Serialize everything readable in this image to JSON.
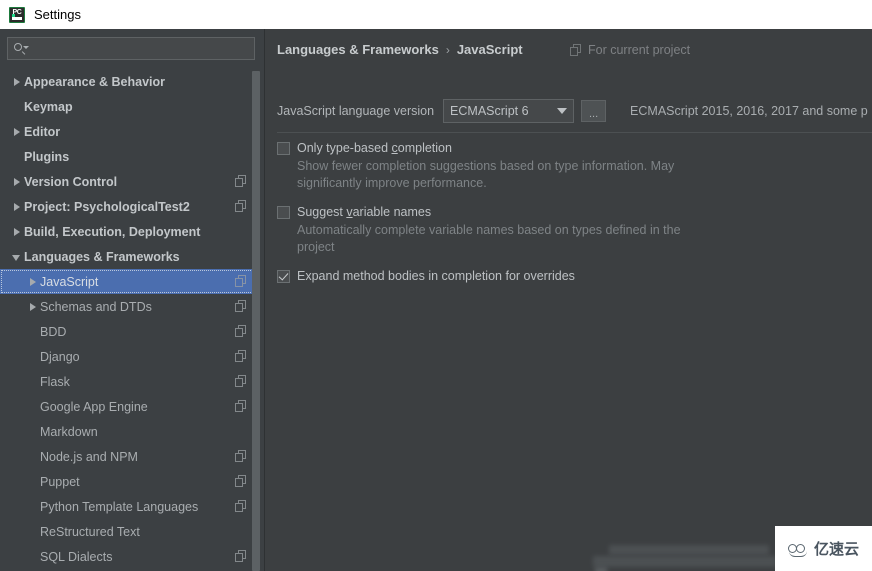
{
  "window": {
    "title": "Settings",
    "app_icon": "pycharm-icon"
  },
  "sidebar": {
    "search": {
      "placeholder": "",
      "value": "",
      "icon": "search-icon"
    },
    "items": [
      {
        "label": "Appearance & Behavior",
        "twisty": "right",
        "level": 0,
        "bold": true,
        "copy": false,
        "selected": false
      },
      {
        "label": "Keymap",
        "twisty": "none",
        "level": 0,
        "bold": true,
        "copy": false,
        "selected": false
      },
      {
        "label": "Editor",
        "twisty": "right",
        "level": 0,
        "bold": true,
        "copy": false,
        "selected": false
      },
      {
        "label": "Plugins",
        "twisty": "none",
        "level": 0,
        "bold": true,
        "copy": false,
        "selected": false
      },
      {
        "label": "Version Control",
        "twisty": "right",
        "level": 0,
        "bold": true,
        "copy": true,
        "selected": false
      },
      {
        "label": "Project: PsychologicalTest2",
        "twisty": "right",
        "level": 0,
        "bold": true,
        "copy": true,
        "selected": false
      },
      {
        "label": "Build, Execution, Deployment",
        "twisty": "right",
        "level": 0,
        "bold": true,
        "copy": false,
        "selected": false
      },
      {
        "label": "Languages & Frameworks",
        "twisty": "down",
        "level": 0,
        "bold": true,
        "copy": false,
        "selected": false
      },
      {
        "label": "JavaScript",
        "twisty": "right",
        "level": 1,
        "bold": false,
        "copy": true,
        "selected": true
      },
      {
        "label": "Schemas and DTDs",
        "twisty": "right",
        "level": 1,
        "bold": false,
        "copy": true,
        "selected": false
      },
      {
        "label": "BDD",
        "twisty": "none",
        "level": 1,
        "bold": false,
        "copy": true,
        "selected": false
      },
      {
        "label": "Django",
        "twisty": "none",
        "level": 1,
        "bold": false,
        "copy": true,
        "selected": false
      },
      {
        "label": "Flask",
        "twisty": "none",
        "level": 1,
        "bold": false,
        "copy": true,
        "selected": false
      },
      {
        "label": "Google App Engine",
        "twisty": "none",
        "level": 1,
        "bold": false,
        "copy": true,
        "selected": false
      },
      {
        "label": "Markdown",
        "twisty": "none",
        "level": 1,
        "bold": false,
        "copy": false,
        "selected": false
      },
      {
        "label": "Node.js and NPM",
        "twisty": "none",
        "level": 1,
        "bold": false,
        "copy": true,
        "selected": false
      },
      {
        "label": "Puppet",
        "twisty": "none",
        "level": 1,
        "bold": false,
        "copy": true,
        "selected": false
      },
      {
        "label": "Python Template Languages",
        "twisty": "none",
        "level": 1,
        "bold": false,
        "copy": true,
        "selected": false
      },
      {
        "label": "ReStructured Text",
        "twisty": "none",
        "level": 1,
        "bold": false,
        "copy": false,
        "selected": false
      },
      {
        "label": "SQL Dialects",
        "twisty": "none",
        "level": 1,
        "bold": false,
        "copy": true,
        "selected": false
      }
    ]
  },
  "content": {
    "breadcrumb": {
      "parent": "Languages & Frameworks",
      "separator": "›",
      "current": "JavaScript"
    },
    "scope_note": {
      "icon": "copy-icon",
      "label": "For current project"
    },
    "language_version": {
      "label": "JavaScript language version",
      "selected": "ECMAScript 6",
      "browse_label": "...",
      "description": "ECMAScript 2015, 2016, 2017 and some p"
    },
    "options": [
      {
        "id": "only-type-based-completion",
        "checked": false,
        "title_before": "Only type-based ",
        "mnemonic": "c",
        "title_after": "ompletion",
        "description": "Show fewer completion suggestions based on type information. May significantly improve performance."
      },
      {
        "id": "suggest-variable-names",
        "checked": false,
        "title_before": "Suggest ",
        "mnemonic": "v",
        "title_after": "ariable names",
        "description": "Automatically complete variable names based on types defined in the project"
      },
      {
        "id": "expand-method-bodies",
        "checked": true,
        "title_before": "Expand method bodies in completion for overrides",
        "mnemonic": "",
        "title_after": "",
        "description": ""
      }
    ]
  },
  "watermark": {
    "text": "亿速云",
    "logo": "cloud-logo"
  },
  "colors": {
    "content_bg": "#3c3f41",
    "sidebar_bg": "#3c4043",
    "selection": "#4b6eaf",
    "text": "#bbbbbb",
    "muted_text": "#7e8386",
    "titlebar_bg": "#ffffff"
  }
}
